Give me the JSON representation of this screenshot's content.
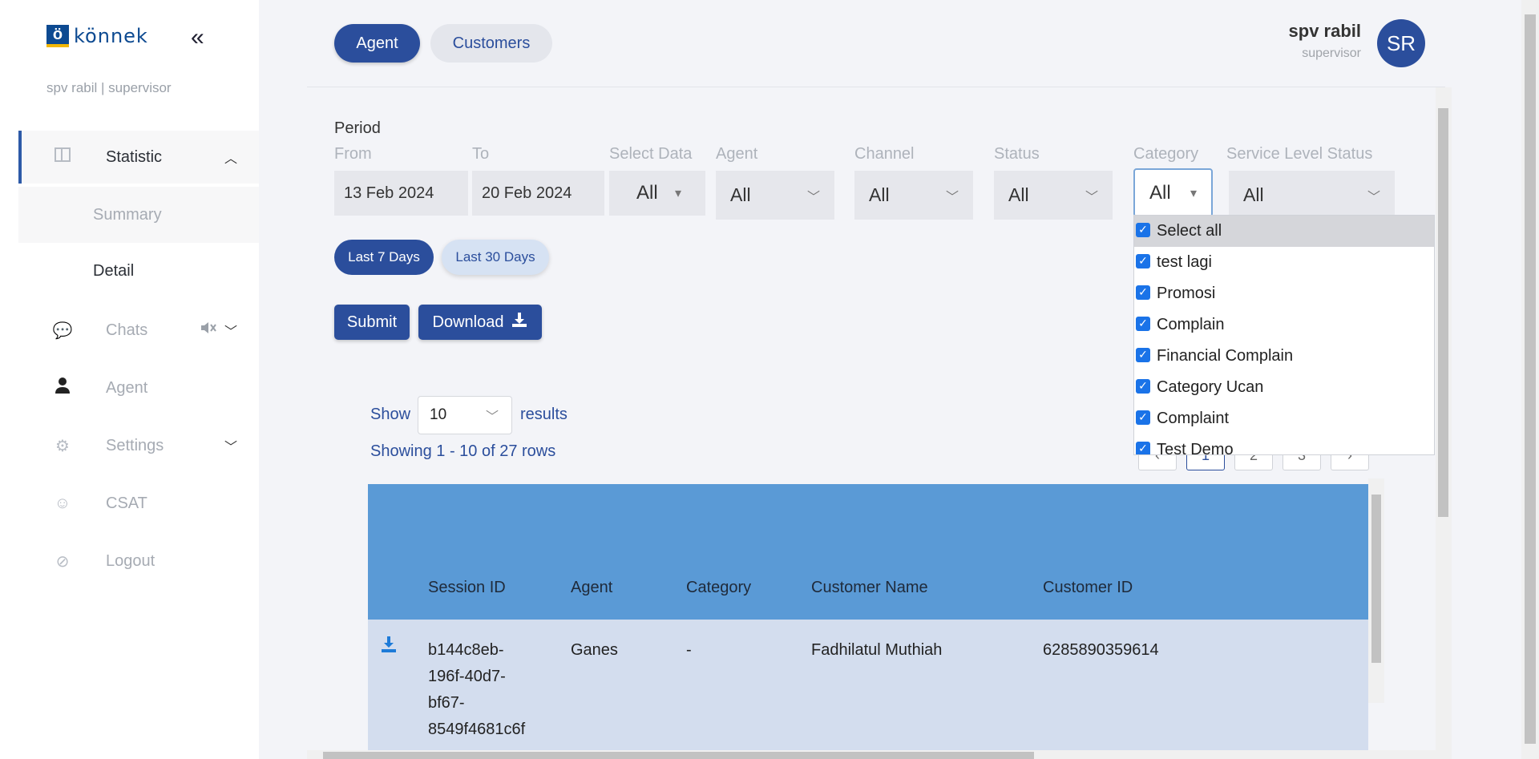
{
  "brand": {
    "logo_mark": "ö",
    "logo_text": "könnek"
  },
  "sidebar": {
    "collapse_icon": "«",
    "user_line": "spv rabil | supervisor",
    "items": [
      {
        "label": "Statistic",
        "icon": "panel-icon"
      },
      {
        "label": "Chats",
        "icon": "chat-icon"
      },
      {
        "label": "Agent",
        "icon": "person-icon"
      },
      {
        "label": "Settings",
        "icon": "gear-icon"
      },
      {
        "label": "CSAT",
        "icon": "smiley-icon"
      },
      {
        "label": "Logout",
        "icon": "logout-icon"
      }
    ],
    "sub_items": [
      {
        "label": "Summary"
      },
      {
        "label": "Detail"
      }
    ]
  },
  "header": {
    "tabs": [
      {
        "label": "Agent"
      },
      {
        "label": "Customers"
      }
    ],
    "profile": {
      "name": "spv rabil",
      "role": "supervisor",
      "initials": "SR"
    }
  },
  "filters": {
    "period_label": "Period",
    "from": {
      "label": "From",
      "value": "13 Feb 2024"
    },
    "to": {
      "label": "To",
      "value": "20 Feb 2024"
    },
    "select_data": {
      "label": "Select Data",
      "value": "All"
    },
    "agent": {
      "label": "Agent",
      "value": "All"
    },
    "channel": {
      "label": "Channel",
      "value": "All"
    },
    "status": {
      "label": "Status",
      "value": "All"
    },
    "category": {
      "label": "Category",
      "value": "All"
    },
    "service_level_status": {
      "label": "Service Level Status",
      "value": "All"
    }
  },
  "quick_ranges": {
    "last7": "Last 7 Days",
    "last30": "Last 30 Days"
  },
  "actions": {
    "submit": "Submit",
    "download": "Download"
  },
  "listing": {
    "show_label": "Show",
    "page_size": "10",
    "results_label": "results",
    "showing_text": "Showing 1 - 10 of 27 rows",
    "pages": [
      "1",
      "2",
      "3"
    ],
    "current_page": "1"
  },
  "table": {
    "columns": [
      "Session ID",
      "Agent",
      "Category",
      "Customer Name",
      "Customer ID"
    ],
    "rows": [
      {
        "session_id": [
          "b144c8eb-",
          "196f-40d7-",
          "bf67-",
          "8549f4681c6f"
        ],
        "agent": "Ganes",
        "category": "-",
        "customer_name": "Fadhilatul Muthiah",
        "customer_id": "6285890359614"
      }
    ]
  },
  "category_dropdown": {
    "options": [
      {
        "label": "Select all",
        "checked": true
      },
      {
        "label": "test lagi",
        "checked": true
      },
      {
        "label": "Promosi",
        "checked": true
      },
      {
        "label": "Complain",
        "checked": true
      },
      {
        "label": "Financial Complain",
        "checked": true
      },
      {
        "label": "Category Ucan",
        "checked": true
      },
      {
        "label": "Complaint",
        "checked": true
      },
      {
        "label": "Test Demo",
        "checked": true
      }
    ]
  },
  "colors": {
    "primary": "#2b4e9c",
    "table_header": "#5a9ad6",
    "row_bg": "#d3ddee",
    "checkbox": "#1a73e8"
  }
}
